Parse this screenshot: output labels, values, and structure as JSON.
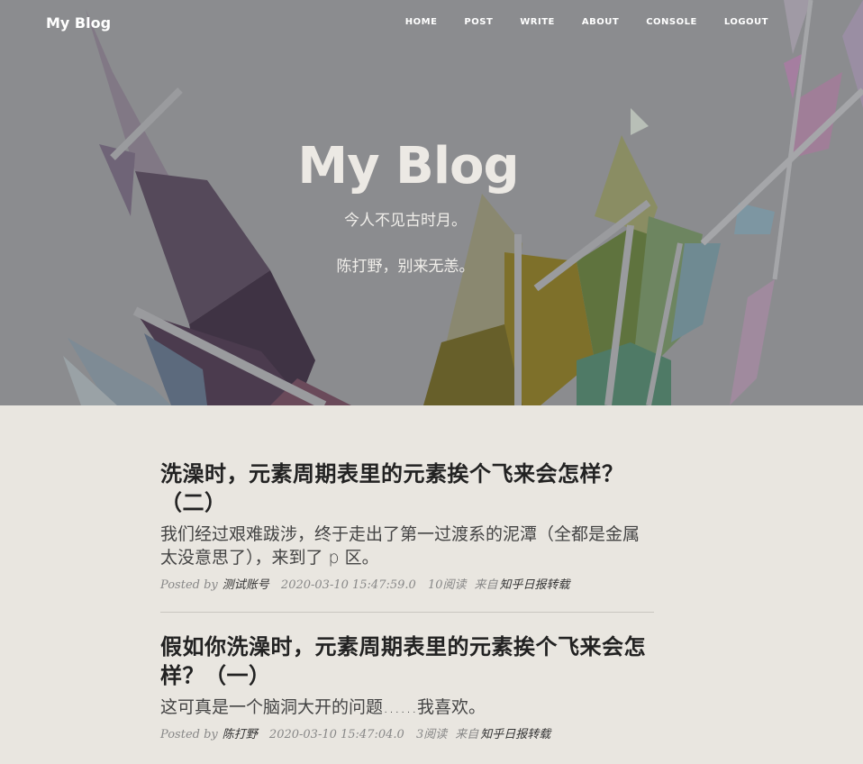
{
  "nav": {
    "brand": "My Blog",
    "links": [
      "HOME",
      "POST",
      "WRITE",
      "ABOUT",
      "CONSOLE",
      "LOGOUT"
    ]
  },
  "hero": {
    "title": "My Blog",
    "subtitle_line1": "今人不见古时月。",
    "subtitle_line2": "陈打野，别来无恙。"
  },
  "posts": [
    {
      "title": "洗澡时，元素周期表里的元素挨个飞来会怎样？（二）",
      "excerpt": "我们经过艰难跋涉，终于走出了第一过渡系的泥潭（全都是金属太没意思了），来到了 p 区。",
      "posted_by_label": "Posted by",
      "author": "测试账号",
      "datetime": "2020-03-10 15:47:59.0",
      "reads": "10阅读",
      "source_label": "来自",
      "source": "知乎日报转载"
    },
    {
      "title": "假如你洗澡时，元素周期表里的元素挨个飞来会怎样？（一）",
      "excerpt": "这可真是一个脑洞大开的问题……我喜欢。",
      "posted_by_label": "Posted by",
      "author": "陈打野",
      "datetime": "2020-03-10 15:47:04.0",
      "reads": "3阅读",
      "source_label": "来自",
      "source": "知乎日报转载"
    }
  ]
}
